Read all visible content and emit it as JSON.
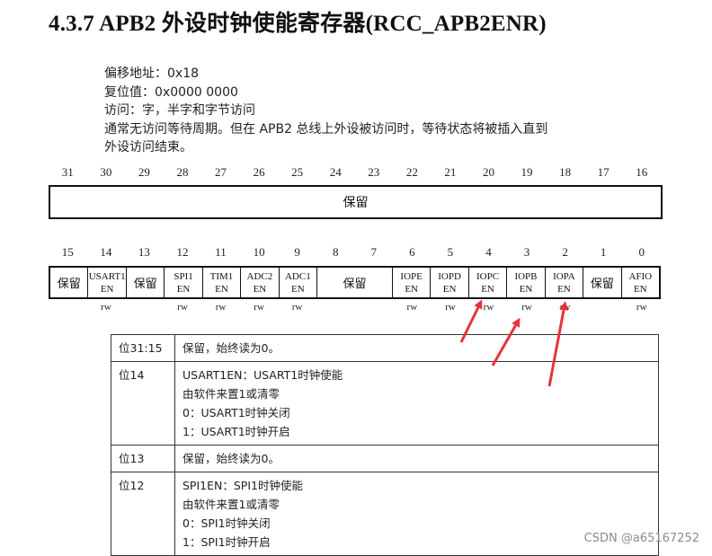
{
  "title": "4.3.7 APB2 外设时钟使能寄存器(RCC_APB2ENR)",
  "description": {
    "lines": [
      "偏移地址：0x18",
      "复位值：0x0000 0000",
      "访问：字，半字和字节访问",
      "通常无访问等待周期。但在 APB2 总线上外设被访问时，等待状态将被插入直到",
      "外设访问结束。"
    ]
  },
  "high_bits": [
    "31",
    "30",
    "29",
    "28",
    "27",
    "26",
    "25",
    "24",
    "23",
    "22",
    "21",
    "20",
    "19",
    "18",
    "17",
    "16"
  ],
  "high_reserved_label": "保留",
  "low_bits": [
    "15",
    "14",
    "13",
    "12",
    "11",
    "10",
    "9",
    "8",
    "7",
    "6",
    "5",
    "4",
    "3",
    "2",
    "1",
    "0"
  ],
  "low_fields": [
    {
      "line1": "保留",
      "line2": ""
    },
    {
      "line1": "USART1",
      "line2": "EN"
    },
    {
      "line1": "保留",
      "line2": ""
    },
    {
      "line1": "SPI1",
      "line2": "EN"
    },
    {
      "line1": "TIM1",
      "line2": "EN"
    },
    {
      "line1": "ADC2",
      "line2": "EN"
    },
    {
      "line1": "ADC1",
      "line2": "EN"
    },
    {
      "line1": "保留",
      "line2": ""
    },
    {
      "line1": "IOPE",
      "line2": "EN"
    },
    {
      "line1": "IOPD",
      "line2": "EN"
    },
    {
      "line1": "IOPC",
      "line2": "EN"
    },
    {
      "line1": "IOPB",
      "line2": "EN"
    },
    {
      "line1": "IOPA",
      "line2": "EN"
    },
    {
      "line1": "保留",
      "line2": ""
    },
    {
      "line1": "AFIO",
      "line2": "EN"
    }
  ],
  "rw_labels": [
    "",
    "rw",
    "",
    "rw",
    "rw",
    "rw",
    "rw",
    "",
    "",
    "rw",
    "rw",
    "rw",
    "rw",
    "rw",
    "",
    "rw"
  ],
  "table_rows": [
    {
      "bit": "位31:15",
      "lines": [
        "保留，始终读为0。"
      ]
    },
    {
      "bit": "位14",
      "lines": [
        "USART1EN：USART1时钟使能",
        "由软件来置1或清零",
        "0：USART1时钟关闭",
        "1：USART1时钟开启"
      ]
    },
    {
      "bit": "位13",
      "lines": [
        "保留，始终读为0。"
      ]
    },
    {
      "bit": "位12",
      "lines": [
        "SPI1EN：SPI1时钟使能",
        "由软件来置1或清零",
        "0：SPI1时钟关闭",
        "1：SPI1时钟开启"
      ]
    }
  ],
  "annotation_color": "#e8333a",
  "watermark": "CSDN @a65167252"
}
